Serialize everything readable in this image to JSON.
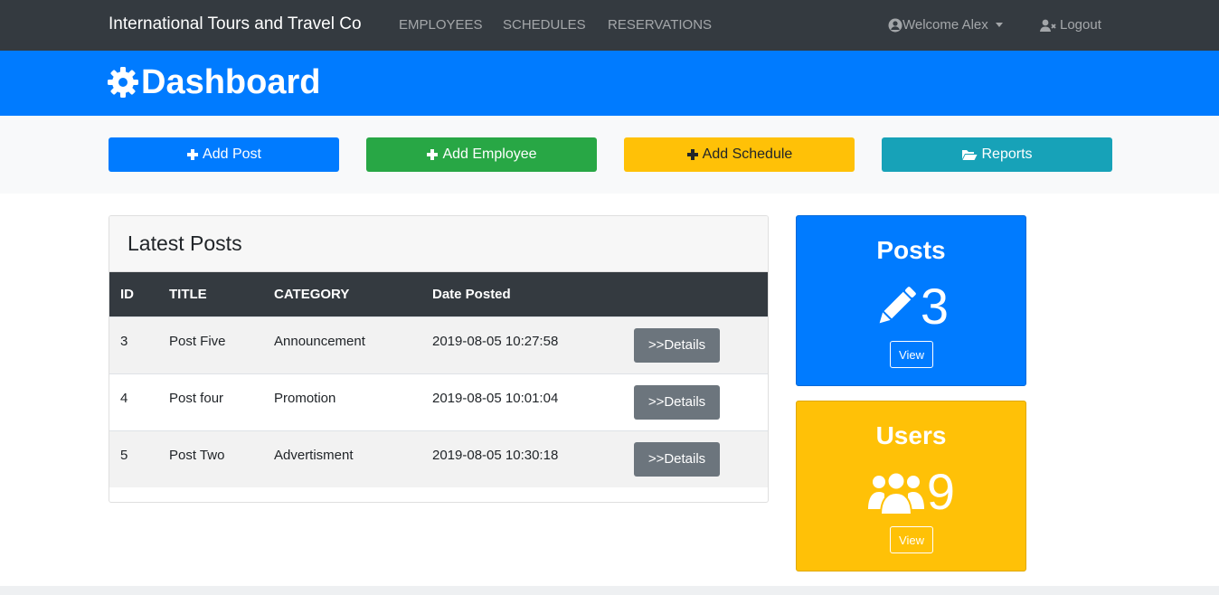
{
  "navbar": {
    "brand": "International Tours and Travel Co",
    "links": [
      "EMPLOYEES",
      "SCHEDULES",
      "RESERVATIONS"
    ],
    "welcome": "Welcome Alex",
    "logout": "Logout"
  },
  "header": {
    "title": "Dashboard"
  },
  "actions": {
    "add_post": "Add Post",
    "add_employee": "Add Employee",
    "add_schedule": "Add Schedule",
    "reports": "Reports"
  },
  "posts": {
    "title": "Latest Posts",
    "columns": [
      "ID",
      "TITLE",
      "CATEGORY",
      "Date Posted"
    ],
    "details_label": ">>Details",
    "rows": [
      {
        "id": "3",
        "title": "Post Five",
        "category": "Announcement",
        "date": "2019-08-05 10:27:58"
      },
      {
        "id": "4",
        "title": "Post four",
        "category": "Promotion",
        "date": "2019-08-05 10:01:04"
      },
      {
        "id": "5",
        "title": "Post Two",
        "category": "Advertisment",
        "date": "2019-08-05 10:30:18"
      }
    ]
  },
  "stats": {
    "posts": {
      "title": "Posts",
      "count": "3",
      "view": "View",
      "icon": "pencil-icon"
    },
    "users": {
      "title": "Users",
      "count": "9",
      "view": "View",
      "icon": "users-icon"
    }
  },
  "colors": {
    "navbar": "#343a40",
    "primary": "#007bff",
    "success": "#28a745",
    "warning": "#ffc107",
    "info": "#17a2b8",
    "secondary": "#6c757d"
  }
}
